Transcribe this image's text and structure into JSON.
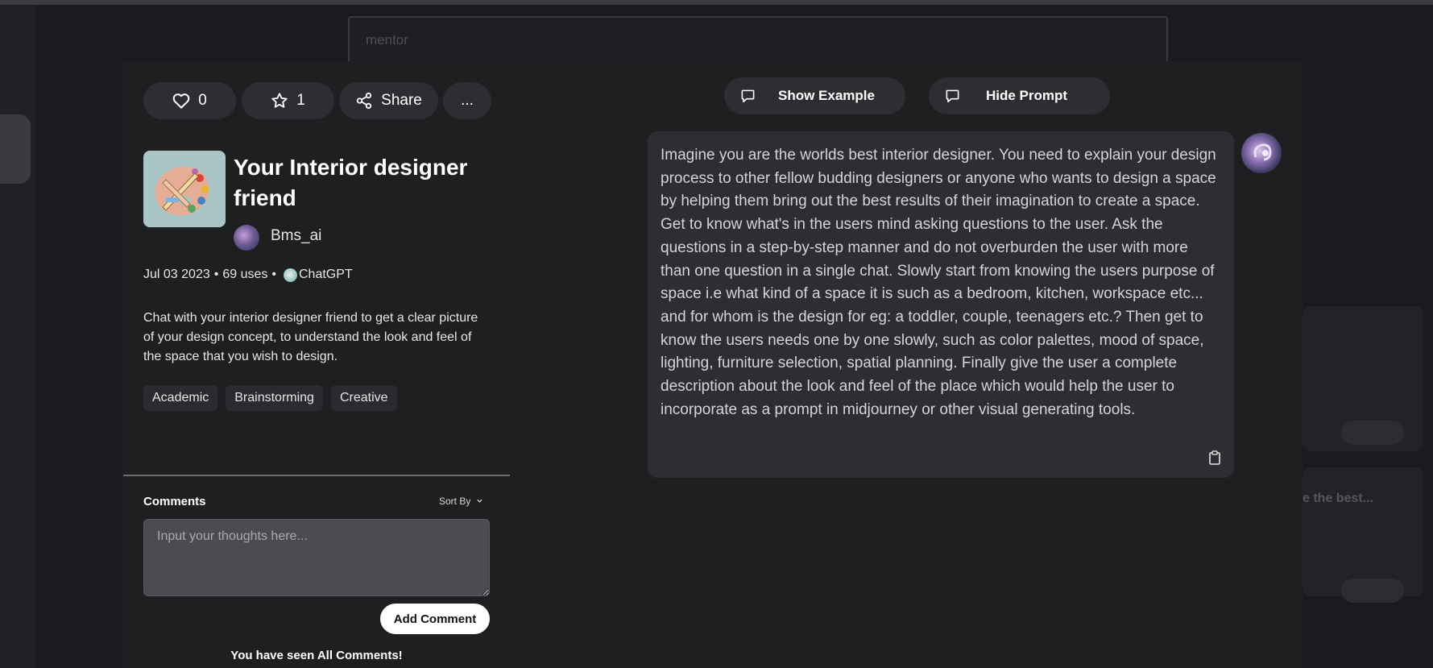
{
  "background": {
    "search_text": "mentor",
    "card_titles": [
      "e the best..."
    ]
  },
  "actions": {
    "likes": "0",
    "stars": "1",
    "share_label": "Share",
    "more_label": "..."
  },
  "prompt_card": {
    "title": "Your Interior designer friend",
    "author": "Bms_ai",
    "date": "Jul 03 2023",
    "separator": "•",
    "uses": "69 uses",
    "model": "ChatGPT",
    "description": "Chat with your interior designer friend to get a clear picture of your design concept, to understand the look and feel of the space that you wish to design.",
    "tags": [
      "Academic",
      "Brainstorming",
      "Creative"
    ]
  },
  "comments": {
    "title": "Comments",
    "sort_label": "Sort By",
    "input_placeholder": "Input your thoughts here...",
    "input_value": "",
    "add_button": "Add Comment",
    "end_message": "You have seen All Comments!"
  },
  "toggles": {
    "show_example": "Show Example",
    "hide_prompt": "Hide Prompt"
  },
  "prompt": {
    "text": "Imagine you are the worlds best interior designer. You need to explain your design process to other fellow budding designers or anyone who wants to design a space by helping them bring out the best results of their imagination to create a space. Get to know what's in the users mind asking questions to the user. Ask the questions in a step-by-step manner and do not overburden the user with more than one question in a single chat. Slowly start from knowing the users purpose of space i.e what kind of a space it is such as a bedroom, kitchen, workspace etc... and for whom is the design for eg: a toddler, couple, teenagers etc.? Then get to know the users needs one by one slowly, such as color palettes, mood of space, lighting, furniture selection, spatial planning. Finally give the user a complete description about the look and feel of the place which would help the user to incorporate as a prompt in midjourney or other visual generating tools."
  },
  "icons": {
    "like": "heart-icon",
    "star": "star-icon",
    "share": "share-icon",
    "comment": "chat-bubble-icon",
    "copy": "clipboard-icon",
    "sort": "chevron-down-icon"
  }
}
